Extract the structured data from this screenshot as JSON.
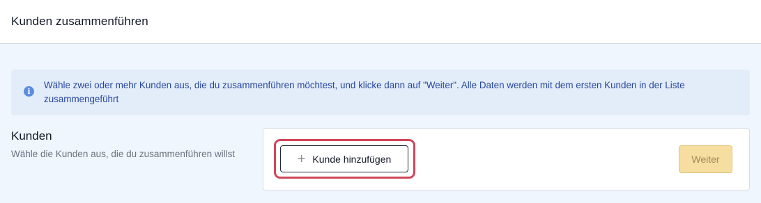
{
  "header": {
    "title": "Kunden zusammenführen"
  },
  "info": {
    "icon": "info-icon",
    "text": "Wähle zwei oder mehr Kunden aus, die du zusammenführen möchtest, und klicke dann auf \"Weiter\". Alle Daten werden mit dem ersten Kunden in der Liste zusammengeführt"
  },
  "section": {
    "title": "Kunden",
    "description": "Wähle die Kunden aus, die du zusammenführen willst"
  },
  "actions": {
    "add_customer_label": "Kunde hinzufügen",
    "add_icon": "plus-icon",
    "next_label": "Weiter",
    "next_disabled": true
  },
  "colors": {
    "accent_highlight": "#d1465a",
    "info_text": "#2746a0",
    "info_background": "#e3edf9",
    "next_button_background": "#f5dea0"
  }
}
